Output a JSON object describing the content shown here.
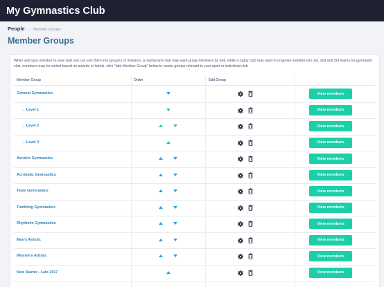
{
  "header": {
    "app_title": "My Gymnastics Club"
  },
  "breadcrumb": {
    "root": "People",
    "separator": "→",
    "current": "Member Groups"
  },
  "page": {
    "title": "Member Groups",
    "description": "When add your member to your club you can sort them into groups,l or instance, a martial arts club may want group members by belt, while a rugby club may want to organise member into 1st, 2nd and 3rd teams.for gymnastic club, members may be sorted based on awards or labels. click \"add Member Group\" below to create groups relevant to your sport or individual club"
  },
  "table": {
    "columns": {
      "name": "Member Group",
      "order": "Order",
      "edit": "Edit Group"
    },
    "button_label": "View members",
    "rows": [
      {
        "name": "General Gymnastics",
        "sub": false,
        "up": false,
        "down": true
      },
      {
        "name": "→ Level 1",
        "sub": true,
        "up": false,
        "down": true
      },
      {
        "name": "→ Level 2",
        "sub": true,
        "up": true,
        "down": true
      },
      {
        "name": "→ Level 3",
        "sub": true,
        "up": true,
        "down": false
      },
      {
        "name": "Aerobic Gymnastics",
        "sub": false,
        "up": true,
        "down": true
      },
      {
        "name": "Acrobatic Gymnastics",
        "sub": false,
        "up": true,
        "down": true
      },
      {
        "name": "Team Gymnastics",
        "sub": false,
        "up": true,
        "down": true
      },
      {
        "name": "Tumbling Gymnastics",
        "sub": false,
        "up": true,
        "down": true
      },
      {
        "name": "Rhythmic Gymnastics",
        "sub": false,
        "up": true,
        "down": true
      },
      {
        "name": "Men's Artistic",
        "sub": false,
        "up": true,
        "down": true
      },
      {
        "name": "Women's Artistic",
        "sub": false,
        "up": true,
        "down": true
      },
      {
        "name": "New Starter - Late 2017",
        "sub": false,
        "up": true,
        "down": false
      }
    ]
  },
  "colors": {
    "topbar": "#1e2233",
    "accent_button": "#1ccfaa",
    "link": "#2d7fb8",
    "arrow": "#2c9ed8",
    "arrow_sub": "#20c9a8"
  },
  "icons": {
    "edit": "gear-icon",
    "delete": "trash-icon",
    "move_up": "arrow-up-icon",
    "move_down": "arrow-down-icon"
  }
}
